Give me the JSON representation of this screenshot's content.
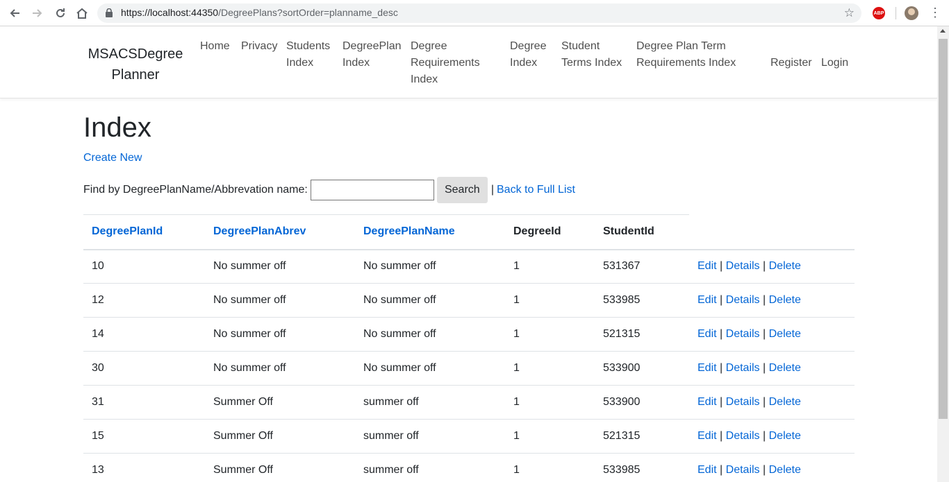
{
  "browser": {
    "url_host": "https://localhost:44350",
    "url_path": "/DegreePlans?sortOrder=planname_desc"
  },
  "navbar": {
    "brand": "MSACSDegreePlanner",
    "links": [
      {
        "label": "Home"
      },
      {
        "label": "Privacy"
      },
      {
        "label": "Students Index"
      },
      {
        "label": "DegreePlan Index"
      },
      {
        "label": "Degree Requirements Index"
      },
      {
        "label": "Degree Index"
      },
      {
        "label": "Student Terms Index"
      },
      {
        "label": "Degree Plan Term Requirements Index"
      },
      {
        "label": "Register"
      },
      {
        "label": "Login"
      }
    ]
  },
  "page": {
    "title": "Index",
    "create_new": "Create New",
    "search_label": "Find by DegreePlanName/Abbrevation name:",
    "search_value": "",
    "search_button": "Search",
    "pipe": "|",
    "back_link": "Back to Full List"
  },
  "table": {
    "headers": [
      "DegreePlanId",
      "DegreePlanAbrev",
      "DegreePlanName",
      "DegreeId",
      "StudentId"
    ],
    "actions": {
      "edit": "Edit",
      "details": "Details",
      "delete": "Delete",
      "sep": "|"
    },
    "rows": [
      [
        "10",
        "No summer off",
        "No summer off",
        "1",
        "531367"
      ],
      [
        "12",
        "No summer off",
        "No summer off",
        "1",
        "533985"
      ],
      [
        "14",
        "No summer off",
        "No summer off",
        "1",
        "521315"
      ],
      [
        "30",
        "No summer off",
        "No summer off",
        "1",
        "533900"
      ],
      [
        "31",
        "Summer Off",
        "summer off",
        "1",
        "533900"
      ],
      [
        "15",
        "Summer Off",
        "summer off",
        "1",
        "521315"
      ],
      [
        "13",
        "Summer Off",
        "summer off",
        "1",
        "533985"
      ]
    ]
  },
  "colors": {
    "link": "#0366d6",
    "text": "#212529",
    "nav_text": "#5a5a5a"
  }
}
